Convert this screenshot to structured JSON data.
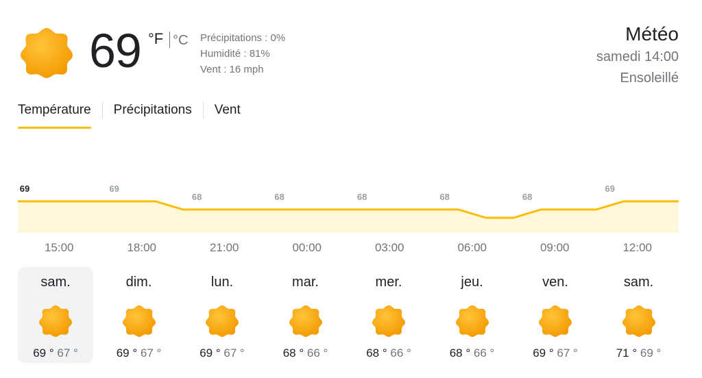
{
  "current": {
    "icon": "sun-icon",
    "temperature": "69",
    "unit_f": "°F",
    "unit_c": "°C",
    "precipitation": "Précipitations : 0%",
    "humidity": "Humidité : 81%",
    "wind": "Vent : 16 mph"
  },
  "header": {
    "title": "Météo",
    "datetime": "samedi 14:00",
    "condition": "Ensoleillé"
  },
  "tabs": [
    {
      "label": "Température",
      "active": true
    },
    {
      "label": "Précipitations",
      "active": false
    },
    {
      "label": "Vent",
      "active": false
    }
  ],
  "colors": {
    "accent": "#fbbc04",
    "fill": "#fef7d9",
    "sun_light": "#ffc43a",
    "sun_dark": "#f29900"
  },
  "chart_data": {
    "type": "area",
    "x": [
      "14:00",
      "15:00",
      "16:00",
      "17:00",
      "18:00",
      "19:00",
      "20:00",
      "21:00",
      "22:00",
      "23:00",
      "00:00",
      "01:00",
      "02:00",
      "03:00",
      "04:00",
      "05:00",
      "06:00",
      "07:00",
      "08:00",
      "09:00",
      "10:00",
      "11:00",
      "12:00",
      "13:00"
    ],
    "values": [
      69,
      69,
      69,
      69,
      69,
      68,
      68,
      68,
      68,
      68,
      68,
      68,
      68,
      68,
      68,
      68,
      67,
      67,
      68,
      68,
      68,
      69,
      69,
      69
    ],
    "labels": [
      {
        "x": "14:00",
        "text": "69",
        "current": true
      },
      {
        "x": "17:00",
        "text": "69"
      },
      {
        "x": "20:00",
        "text": "68"
      },
      {
        "x": "23:00",
        "text": "68"
      },
      {
        "x": "02:00",
        "text": "68"
      },
      {
        "x": "05:00",
        "text": "68"
      },
      {
        "x": "08:00",
        "text": "68"
      },
      {
        "x": "11:00",
        "text": "69"
      }
    ],
    "xticks": [
      "15:00",
      "18:00",
      "21:00",
      "00:00",
      "03:00",
      "06:00",
      "09:00",
      "12:00"
    ]
  },
  "days": [
    {
      "name": "sam.",
      "icon": "sun-icon",
      "high": "69",
      "low": "67",
      "selected": true
    },
    {
      "name": "dim.",
      "icon": "sun-icon",
      "high": "69",
      "low": "67"
    },
    {
      "name": "lun.",
      "icon": "sun-icon",
      "high": "69",
      "low": "67"
    },
    {
      "name": "mar.",
      "icon": "sun-icon",
      "high": "68",
      "low": "66"
    },
    {
      "name": "mer.",
      "icon": "sun-icon",
      "high": "68",
      "low": "66"
    },
    {
      "name": "jeu.",
      "icon": "sun-icon",
      "high": "68",
      "low": "66"
    },
    {
      "name": "ven.",
      "icon": "sun-icon",
      "high": "69",
      "low": "67"
    },
    {
      "name": "sam.",
      "icon": "sun-icon",
      "high": "71",
      "low": "69"
    }
  ],
  "degree_symbol": "°"
}
